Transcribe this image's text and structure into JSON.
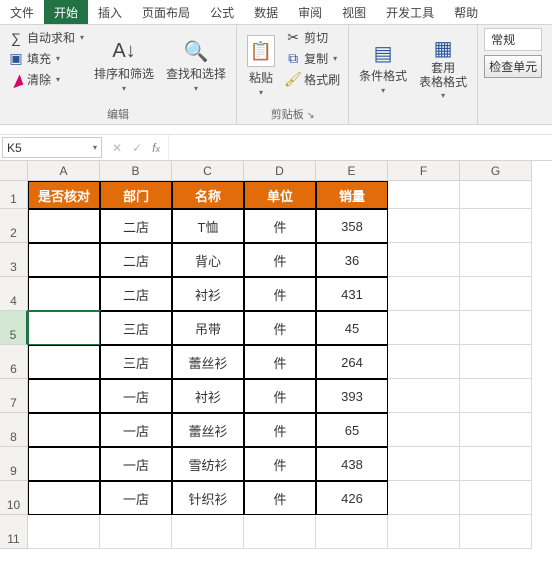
{
  "tabs": [
    "文件",
    "开始",
    "插入",
    "页面布局",
    "公式",
    "数据",
    "审阅",
    "视图",
    "开发工具",
    "帮助"
  ],
  "active_tab_index": 1,
  "ribbon": {
    "autosum": "自动求和",
    "fill": "填充",
    "clear": "清除",
    "edit_group": "编辑",
    "sort_filter": "排序和筛选",
    "find_select": "查找和选择",
    "paste": "粘贴",
    "cut": "剪切",
    "copy": "复制",
    "format_painter": "格式刷",
    "clipboard_group": "剪贴板",
    "cond_format": "条件格式",
    "table_format_l1": "套用",
    "table_format_l2": "表格格式",
    "number_style": "常规",
    "check_cell": "检查单元"
  },
  "namebox": "K5",
  "columns": [
    "A",
    "B",
    "C",
    "D",
    "E",
    "F",
    "G"
  ],
  "headers": [
    "是否核对",
    "部门",
    "名称",
    "单位",
    "销量"
  ],
  "rows": [
    {
      "a": "",
      "b": "二店",
      "c": "T恤",
      "d": "件",
      "e": "358"
    },
    {
      "a": "",
      "b": "二店",
      "c": "背心",
      "d": "件",
      "e": "36"
    },
    {
      "a": "",
      "b": "二店",
      "c": "衬衫",
      "d": "件",
      "e": "431"
    },
    {
      "a": "",
      "b": "三店",
      "c": "吊带",
      "d": "件",
      "e": "45"
    },
    {
      "a": "",
      "b": "三店",
      "c": "蕾丝衫",
      "d": "件",
      "e": "264"
    },
    {
      "a": "",
      "b": "一店",
      "c": "衬衫",
      "d": "件",
      "e": "393"
    },
    {
      "a": "",
      "b": "一店",
      "c": "蕾丝衫",
      "d": "件",
      "e": "65"
    },
    {
      "a": "",
      "b": "一店",
      "c": "雪纺衫",
      "d": "件",
      "e": "438"
    },
    {
      "a": "",
      "b": "一店",
      "c": "针织衫",
      "d": "件",
      "e": "426"
    }
  ],
  "selected_row": 5
}
